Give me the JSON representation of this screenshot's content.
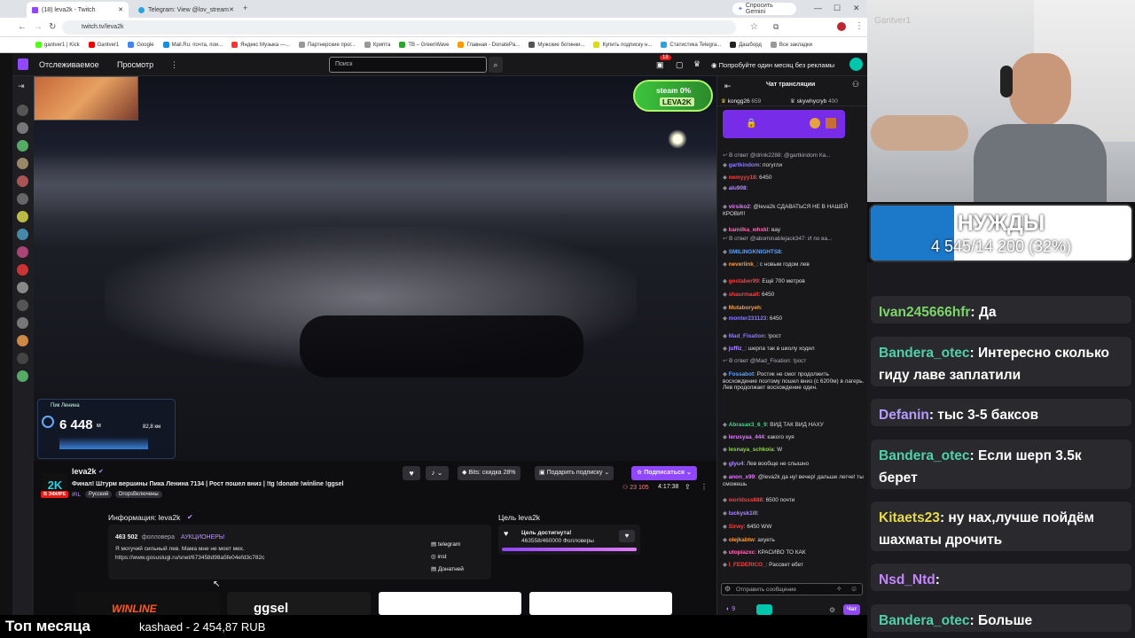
{
  "browser": {
    "tabs": [
      {
        "label": "(18) leva2k - Twitch",
        "active": true
      },
      {
        "label": "Telegram: View @lov_stream",
        "active": false
      }
    ],
    "gemini_label": "Спросить Gemini",
    "url": "twitch.tv/leva2k",
    "bookmarks": [
      "gantver1 | Kick",
      "Gantver1",
      "Google",
      "Mail.Ru: почта, пои...",
      "Яндекс Музыка —...",
      "Партнерские прог...",
      "Крипта",
      "TB – GreenWave",
      "Главная - DonatePa...",
      "Мужские ботинки...",
      "Купить подписку н...",
      "Статистика Telegra...",
      "Дашборд",
      "Все закладки"
    ]
  },
  "twitch": {
    "nav_following": "Отслеживаемое",
    "nav_browse": "Просмотр",
    "search_placeholder": "Поиск",
    "notif_count": "18",
    "promo": "Попробуйте один месяц без рекламы"
  },
  "video": {
    "overlay_badge": "steam 0%",
    "overlay_brand": "LEVA2K",
    "peak_name": "Пик Ленина",
    "altitude": "6 448",
    "altitude_unit": "м",
    "speed": "82,8 км"
  },
  "stream": {
    "channel": "leva2k",
    "title": "Финал! Штурм вершины Пика Ленина 7134 | Рост пошел вниз | !tg !donate !winline !ggsel",
    "live": "В ЭФИРЕ",
    "category": "IRL",
    "tags": [
      "Русский",
      "DropsВключены"
    ],
    "bits_label": "Bits: скидка 28%",
    "gift_label": "Подарить подписку",
    "subscribe_label": "Подписаться",
    "viewers": "23 105",
    "uptime": "4:17:38"
  },
  "about": {
    "heading": "Информация: leva2k",
    "followers": "463 502",
    "followers_label": "фолловера",
    "team": "АУКЦИОНЕРЫ",
    "bio": "Я могучий сильный лев. Мама мне не моет мех.",
    "link": "https://www.gosuslugi.ru/snet/673458d98a5fe04efd3c782c",
    "links": [
      "telegram",
      "inst",
      "Донатней"
    ]
  },
  "goal": {
    "heading": "Цель leva2k",
    "status": "Цель достигнута!",
    "progress_text": "463558/460000 Фолловеры",
    "progress_fraction": 1.0
  },
  "panels": [
    "WINLINE",
    "ggsel"
  ],
  "chat": {
    "header": "Чат трансляции",
    "top_user_1": "kongg26",
    "top_count_1": "659",
    "top_user_2": "skywhycryb",
    "top_count_2": "400",
    "messages": [
      {
        "user": "",
        "text": "В ответ @drink2288: @gartkindom Ка...",
        "color": "#adadb8"
      },
      {
        "user": "gartkindom",
        "text": ": погугли",
        "color": "#8a7cff"
      },
      {
        "user": "nemyyy18",
        "text": ": 6450",
        "color": "#ff3d3d"
      },
      {
        "user": "alu908",
        "text": ":",
        "color": "#b08cff"
      },
      {
        "user": "virsiko2",
        "text": ": @leva2k СДАВАТЬСЯ НЕ В НАШЕЙ КРОВИ!!",
        "color": "#e37bff"
      },
      {
        "user": "kamilka_whxkl",
        "text": ": вау",
        "color": "#ff69b4"
      },
      {
        "user": "",
        "text": "В ответ @abominablejack347: И по ва...",
        "color": "#adadb8"
      },
      {
        "user": "SMILINGKNIGHTS8",
        "text": ":",
        "color": "#5aa2ff"
      },
      {
        "user": "neverlink_",
        "text": ": с новым годом лев",
        "color": "#ff9a3d"
      },
      {
        "user": "gostaber99",
        "text": ": Ещё 700 метров",
        "color": "#ff3d3d"
      },
      {
        "user": "shaurmaall",
        "text": ": 6450",
        "color": "#ff3d3d"
      },
      {
        "user": "Mutaboryeh",
        "text": ":",
        "color": "#ff9a3d"
      },
      {
        "user": "monter231123",
        "text": ": 6450",
        "color": "#8a7cff"
      },
      {
        "user": "Mad_Fixation",
        "text": ": !рост",
        "color": "#8a7cff"
      },
      {
        "user": "juffiz_",
        "text": ": шерпа так в школу ходил",
        "color": "#b08cff"
      },
      {
        "user": "",
        "text": "В ответ @Mad_Fixation: !рост",
        "color": "#adadb8"
      },
      {
        "user": "Fossabot",
        "text": ": Ростик не смог продолжить восхождение поэтому пошел вниз (с 6200м) в лагерь. Лев продолжает восхождение один.",
        "color": "#5aa2ff"
      },
      {
        "user": "Abrasax3_6_9",
        "text": ": ВИД ТАК ВИД НАХУ",
        "color": "#3dd68c"
      },
      {
        "user": "lerusyaa_444",
        "text": ": какого хуя",
        "color": "#e37bff"
      },
      {
        "user": "lesnaya_schkola",
        "text": ": W",
        "color": "#8fd14f"
      },
      {
        "user": "glyu4",
        "text": ": Лев вообще не слышно",
        "color": "#b08cff"
      },
      {
        "user": "anon_x99",
        "text": ": @leva2k да ну! вечер! дальше легче! ты сможешь",
        "color": "#e37bff"
      },
      {
        "user": "worldsss888",
        "text": ": 6500 почти",
        "color": "#ff3d3d"
      },
      {
        "user": "luckysk1lll",
        "text": ":",
        "color": "#b08cff"
      },
      {
        "user": "Sirwy",
        "text": ": 6450 WW",
        "color": "#ff3d3d"
      },
      {
        "user": "olejkabtw",
        "text": ": ахуеть",
        "color": "#ff9a3d"
      },
      {
        "user": "utopiazxc",
        "text": ": КРАСИВО ТО КАК",
        "color": "#ff69b4"
      },
      {
        "user": "I_FEDERICO_",
        "text": ": Рассвет ебет",
        "color": "#ff3d3d"
      }
    ],
    "input_placeholder": "Отправить сообщение",
    "points": "9",
    "send_label": "Чат"
  },
  "overlay": {
    "goal_title": "НУЖДЫ",
    "goal_progress": "4 545/14 200 (32%)",
    "goal_fraction": 0.32,
    "chat": [
      {
        "user": "Ivan245666hfr",
        "text": ": Да",
        "color": "#7bd66a"
      },
      {
        "user": "Bandera_otec",
        "text": ": Интересно сколько гиду лаве заплатили",
        "color": "#4fd0a8"
      },
      {
        "user": "Defanin",
        "text": ": тыс 3-5 баксов",
        "color": "#b59cff"
      },
      {
        "user": "Bandera_otec",
        "text": ": Если шерп 3.5к берет",
        "color": "#4fd0a8"
      },
      {
        "user": "Kitaets23",
        "text": ": ну нах,лучше пойдём шахматы дрочить",
        "color": "#e6d94a"
      },
      {
        "user": "Nsd_Ntd",
        "text": ":",
        "color": "#c585ff"
      },
      {
        "user": "Bandera_otec",
        "text": ": Больше",
        "color": "#4fd0a8"
      }
    ]
  },
  "bottom": {
    "label": "Топ месяца",
    "top_donor": "kashaed - 2 454,87 RUB"
  },
  "webcam": {
    "watermark": "Gantver1"
  },
  "colors": {
    "twitch_purple": "#9146ff",
    "bg": "#0e0e10",
    "chat_bg": "#18181b"
  }
}
